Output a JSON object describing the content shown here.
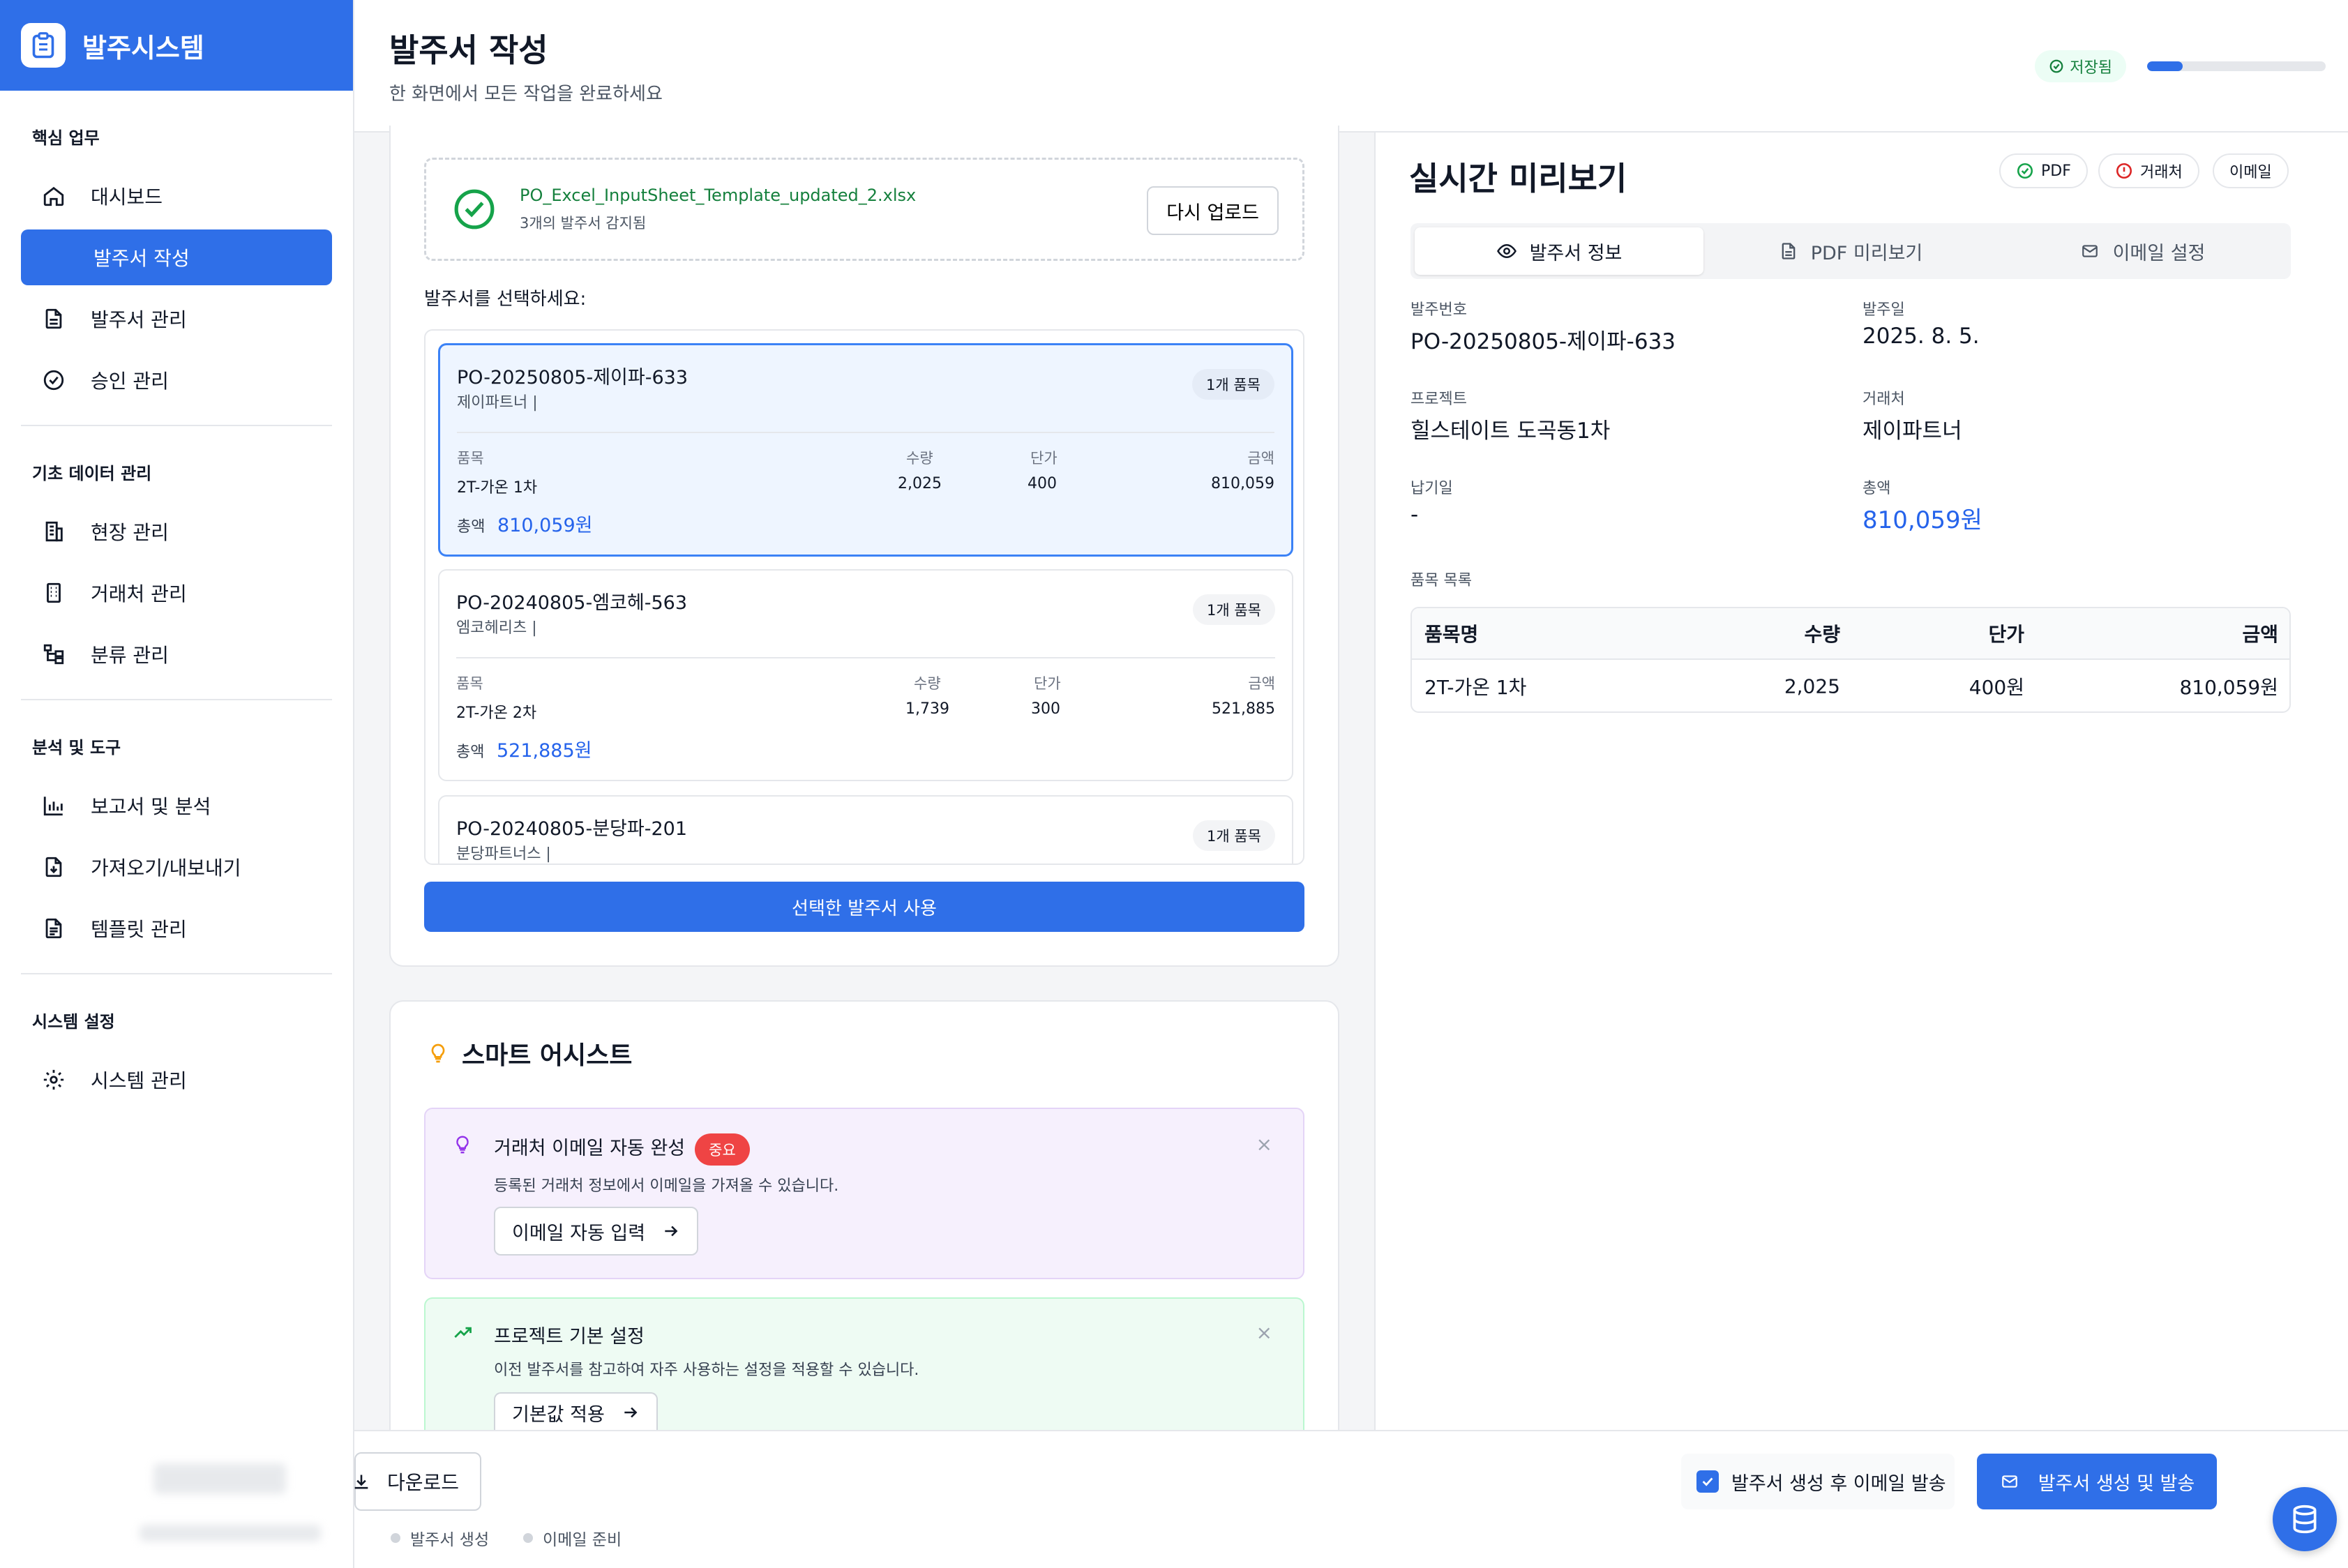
{
  "app": {
    "title": "발주시스템"
  },
  "sidebar": {
    "sections": [
      {
        "title": "핵심 업무",
        "items": [
          {
            "label": "대시보드",
            "icon": "home-icon"
          },
          {
            "label": "발주서 작성",
            "icon": "none",
            "active": true
          },
          {
            "label": "발주서 관리",
            "icon": "document-icon"
          },
          {
            "label": "승인 관리",
            "icon": "check-circle-icon"
          }
        ]
      },
      {
        "title": "기초 데이터 관리",
        "items": [
          {
            "label": "현장 관리",
            "icon": "building-icon"
          },
          {
            "label": "거래처 관리",
            "icon": "office-icon"
          },
          {
            "label": "분류 관리",
            "icon": "tree-icon"
          }
        ]
      },
      {
        "title": "분석 및 도구",
        "items": [
          {
            "label": "보고서 및 분석",
            "icon": "bar-chart-icon"
          },
          {
            "label": "가져오기/내보내기",
            "icon": "file-download-icon"
          },
          {
            "label": "템플릿 관리",
            "icon": "file-text-icon"
          }
        ]
      },
      {
        "title": "시스템 설정",
        "items": [
          {
            "label": "시스템 관리",
            "icon": "gear-icon"
          }
        ]
      }
    ]
  },
  "header": {
    "title": "발주서 작성",
    "subtitle": "한 화면에서 모든 작업을 완료하세요",
    "saved_label": "저장됨",
    "progress": 0.2
  },
  "upload": {
    "filename": "PO_Excel_InputSheet_Template_updated_2.xlsx",
    "detected": "3개의 발주서 감지됨",
    "reupload_label": "다시 업로드"
  },
  "po_select": {
    "label": "발주서를 선택하세요:",
    "columns": {
      "item": "품목",
      "qty": "수량",
      "price": "단가",
      "amount": "금액"
    },
    "total_label": "총액",
    "orders": [
      {
        "id": "PO-20250805-제이파-633",
        "vendor": "제이파트너 |",
        "badge": "1개 품목",
        "item": "2T-가온 1차",
        "qty": "2,025",
        "price": "400",
        "amount": "810,059",
        "total": "810,059원"
      },
      {
        "id": "PO-20240805-엠코헤-563",
        "vendor": "엠코헤리츠 |",
        "badge": "1개 품목",
        "item": "2T-가온 2차",
        "qty": "1,739",
        "price": "300",
        "amount": "521,885",
        "total": "521,885원"
      },
      {
        "id": "PO-20240805-분당파-201",
        "vendor": "분당파트너스 |",
        "badge": "1개 품목"
      }
    ],
    "use_button": "선택한 발주서 사용"
  },
  "assist": {
    "title": "스마트 어시스트",
    "tips": [
      {
        "title": "거래처 이메일 자동 완성",
        "badge": "중요",
        "desc": "등록된 거래처 정보에서 이메일을 가져올 수 있습니다.",
        "button": "이메일 자동 입력",
        "close": "×"
      },
      {
        "title": "프로젝트 기본 설정",
        "desc": "이전 발주서를 참고하여 자주 사용하는 설정을 적용할 수 있습니다.",
        "button": "기본값 적용",
        "close": "×"
      }
    ]
  },
  "preview": {
    "title": "실시간 미리보기",
    "chips": {
      "pdf": "PDF",
      "vendor": "거래처",
      "email": "이메일"
    },
    "tabs": [
      "발주서 정보",
      "PDF 미리보기",
      "이메일 설정"
    ],
    "fields": {
      "po_number_label": "발주번호",
      "po_number": "PO-20250805-제이파-633",
      "order_date_label": "발주일",
      "order_date": "2025. 8. 5.",
      "project_label": "프로젝트",
      "project": "힐스테이트 도곡동1차",
      "vendor_label": "거래처",
      "vendor": "제이파트너",
      "delivery_label": "납기일",
      "delivery": "-",
      "total_label": "총액",
      "total": "810,059원"
    },
    "items_label": "품목 목록",
    "table": {
      "headers": [
        "품목명",
        "수량",
        "단가",
        "금액"
      ],
      "rows": [
        [
          "2T-가온 1차",
          "2,025",
          "400원",
          "810,059원"
        ]
      ]
    }
  },
  "footer": {
    "download_label": "다운로드",
    "status": [
      "발주서 생성",
      "이메일 준비"
    ],
    "email_checkbox_label": "발주서 생성 후 이메일 발송",
    "generate_label": "발주서 생성 및 발송"
  },
  "colors": {
    "primary": "#2f6fe8",
    "success": "#15803d",
    "danger": "#ef4444",
    "link": "#2563eb"
  }
}
